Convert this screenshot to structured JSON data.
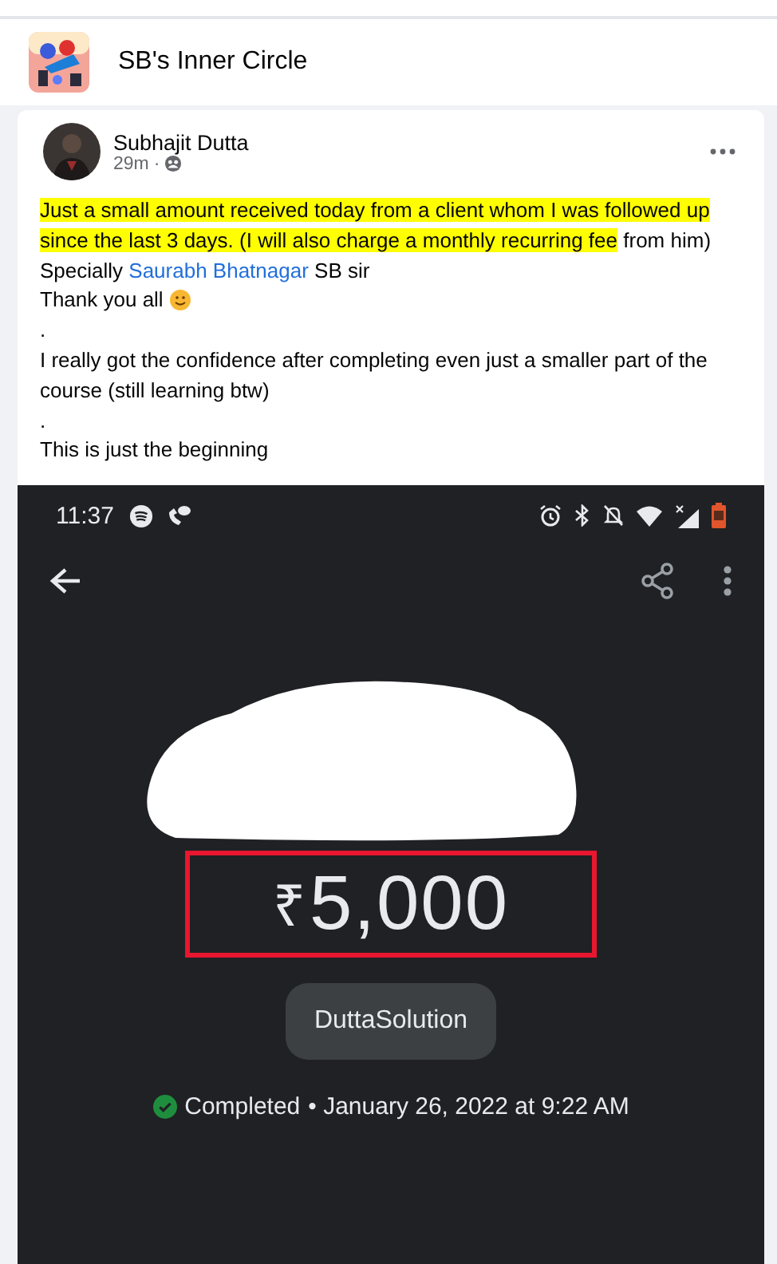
{
  "group": {
    "name": "SB's Inner Circle"
  },
  "post": {
    "author": "Subhajit Dutta",
    "time": "29m",
    "audience_separator": "·",
    "paragraphs": [
      {
        "kind": "highlight",
        "highlighted": "Just a small amount received today from a client whom I was followed up since the last 3 days. (I will also charge a monthly recurring fee",
        "rest": "from him)"
      },
      {
        "kind": "mention",
        "before": "Specially",
        "link": "Saurabh Bhatnagar",
        "after": "SB sir"
      },
      {
        "kind": "emoji",
        "text": "Thank you all"
      },
      {
        "kind": "plain",
        "text": "."
      },
      {
        "kind": "plain",
        "text": "I really got the confidence after completing even just a smaller part of the course (still learning btw)"
      },
      {
        "kind": "plain",
        "text": "."
      },
      {
        "kind": "plain",
        "text": "This is just the beginning"
      }
    ]
  },
  "screenshot": {
    "status_time": "11:37",
    "amount_symbol": "₹",
    "amount": "5,000",
    "payee": "DuttaSolution",
    "status": "Completed",
    "status_detail": "• January 26, 2022 at 9:22 AM",
    "completed": true
  }
}
